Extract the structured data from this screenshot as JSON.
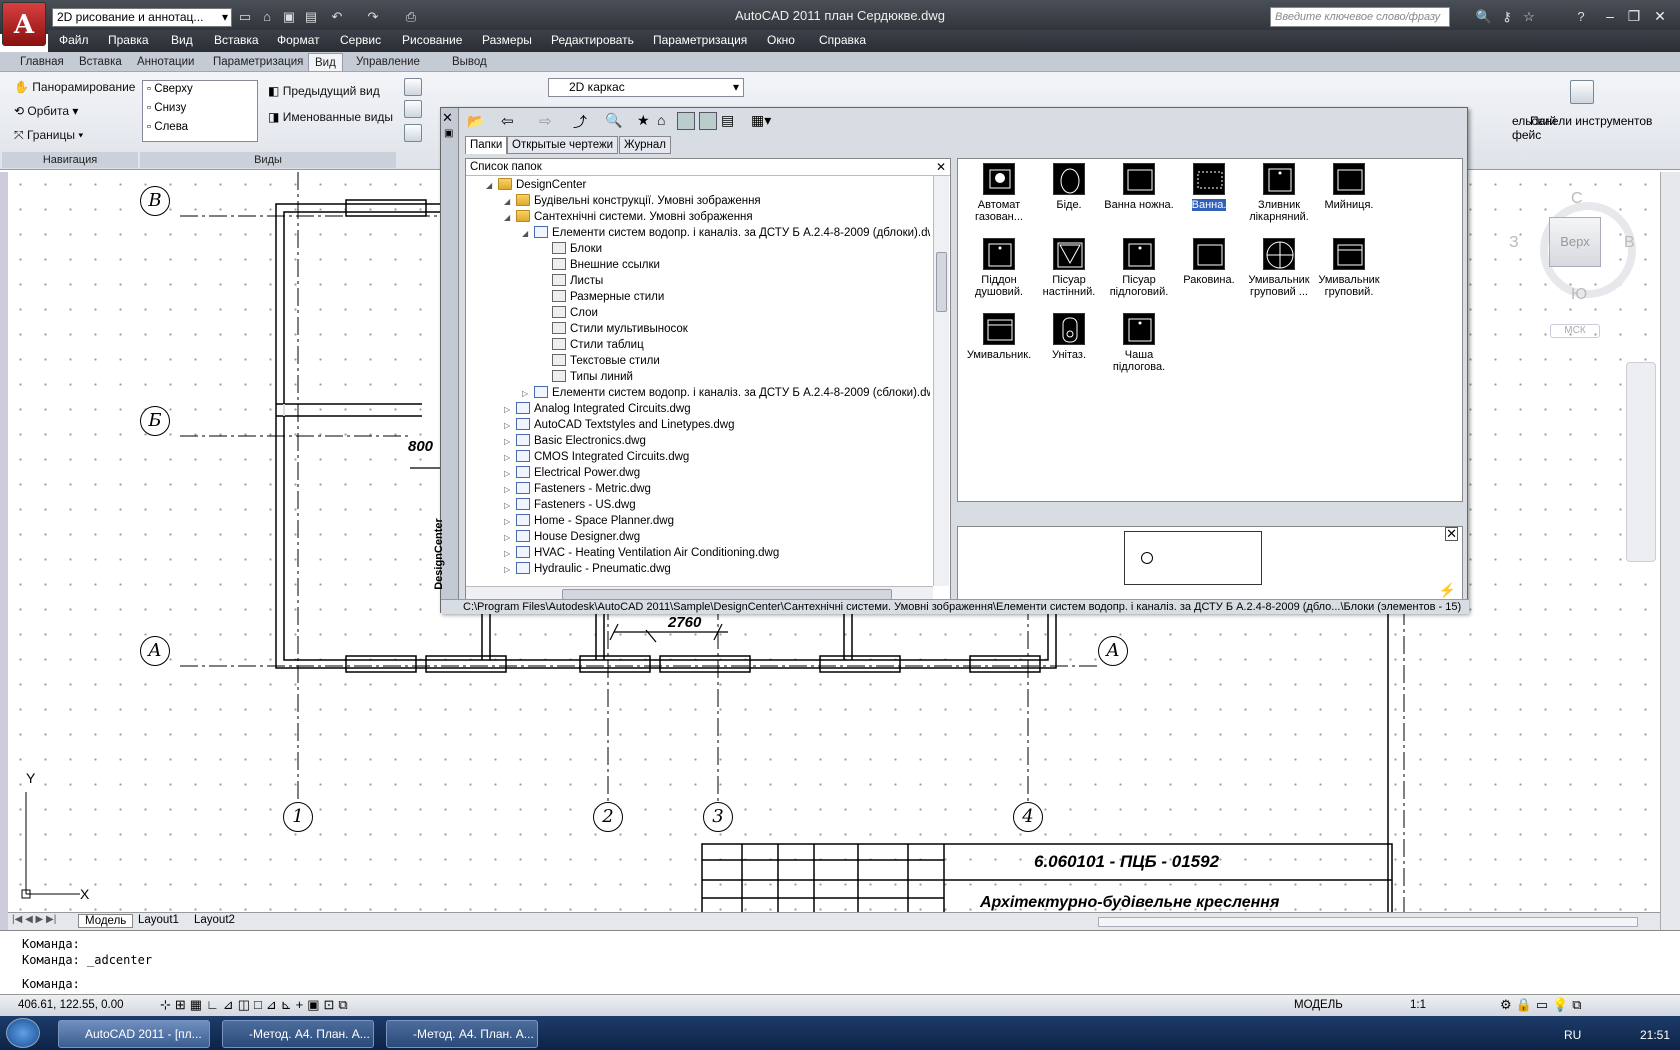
{
  "app": {
    "title": "AutoCAD 2011    план Сердюкве.dwg",
    "workspace": "2D рисование и аннотац...",
    "search_placeholder": "Введите ключевое слово/фразу",
    "logo_letter": "A"
  },
  "menu": [
    "Файл",
    "Правка",
    "Вид",
    "Вставка",
    "Формат",
    "Сервис",
    "Рисование",
    "Размеры",
    "Редактировать",
    "Параметризация",
    "Окно",
    "Справка"
  ],
  "ribbon_tabs": [
    "Главная",
    "Вставка",
    "Аннотации",
    "Параметризация",
    "Вид",
    "Управление",
    "Вывод"
  ],
  "ribbon_active_tab": "Вид",
  "ribbon": {
    "nav": {
      "pan": "Панорамирование",
      "orbit": "Орбита",
      "extents": "Границы",
      "title": "Навигация"
    },
    "views": {
      "items": [
        "Сверху",
        "Снизу",
        "Слева"
      ],
      "prev": "Предыдущий вид",
      "named": "Именованные виды",
      "title": "Виды"
    },
    "visual_style": "2D каркас",
    "ui_partial": "ельский\nфейс",
    "toolpalettes": "Панели инструментов",
    "ui_title_partial": "а"
  },
  "designcenter": {
    "side_title": "DesignCenter",
    "tabs": [
      "Папки",
      "Открытые чертежи",
      "Журнал"
    ],
    "tree_header": "Список папок",
    "tree": [
      {
        "indent": 1,
        "icon": "folder",
        "label": "DesignCenter"
      },
      {
        "indent": 2,
        "icon": "folder",
        "label": "Будівельні конструкції. Умовні зображення"
      },
      {
        "indent": 2,
        "icon": "folder",
        "label": "Сантехнічні системи. Умовні зображення"
      },
      {
        "indent": 3,
        "icon": "dwg",
        "label": "Елементи систем водопр. і каналіз. за ДСТУ Б А.2.4-8-2009 (дблоки).dwg"
      },
      {
        "indent": 4,
        "icon": "sub",
        "label": "Блоки"
      },
      {
        "indent": 4,
        "icon": "sub",
        "label": "Внешние ссылки"
      },
      {
        "indent": 4,
        "icon": "sub",
        "label": "Листы"
      },
      {
        "indent": 4,
        "icon": "sub",
        "label": "Размерные стили"
      },
      {
        "indent": 4,
        "icon": "sub",
        "label": "Слои"
      },
      {
        "indent": 4,
        "icon": "sub",
        "label": "Стили мультивыносок"
      },
      {
        "indent": 4,
        "icon": "sub",
        "label": "Стили таблиц"
      },
      {
        "indent": 4,
        "icon": "sub",
        "label": "Текстовые стили"
      },
      {
        "indent": 4,
        "icon": "sub",
        "label": "Типы линий"
      },
      {
        "indent": 3,
        "icon": "dwg",
        "label": "Елементи систем водопр. і каналіз. за ДСТУ Б А.2.4-8-2009 (сблоки).dwg"
      },
      {
        "indent": 2,
        "icon": "dwg",
        "label": "Analog Integrated Circuits.dwg"
      },
      {
        "indent": 2,
        "icon": "dwg",
        "label": "AutoCAD Textstyles and Linetypes.dwg"
      },
      {
        "indent": 2,
        "icon": "dwg",
        "label": "Basic Electronics.dwg"
      },
      {
        "indent": 2,
        "icon": "dwg",
        "label": "CMOS Integrated Circuits.dwg"
      },
      {
        "indent": 2,
        "icon": "dwg",
        "label": "Electrical Power.dwg"
      },
      {
        "indent": 2,
        "icon": "dwg",
        "label": "Fasteners - Metric.dwg"
      },
      {
        "indent": 2,
        "icon": "dwg",
        "label": "Fasteners - US.dwg"
      },
      {
        "indent": 2,
        "icon": "dwg",
        "label": "Home - Space Planner.dwg"
      },
      {
        "indent": 2,
        "icon": "dwg",
        "label": "House Designer.dwg"
      },
      {
        "indent": 2,
        "icon": "dwg",
        "label": "HVAC - Heating Ventilation Air Conditioning.dwg"
      },
      {
        "indent": 2,
        "icon": "dwg",
        "label": "Hydraulic - Pneumatic.dwg"
      }
    ],
    "blocks": [
      {
        "label": "Автомат газован...",
        "shape": "circle-fill"
      },
      {
        "label": "Біде.",
        "shape": "egg"
      },
      {
        "label": "Ванна ножна.",
        "shape": "rect"
      },
      {
        "label": "Ванна.",
        "shape": "rect-sel",
        "selected": true
      },
      {
        "label": "Зливник лікарняний.",
        "shape": "rect-dot"
      },
      {
        "label": "Мийниця.",
        "shape": "rect"
      },
      {
        "label": "Піддон душовий.",
        "shape": "rect-dot"
      },
      {
        "label": "Пісуар настінний.",
        "shape": "tri"
      },
      {
        "label": "Пісуар підлоговий.",
        "shape": "rect-dot"
      },
      {
        "label": "Раковина.",
        "shape": "rect"
      },
      {
        "label": "Умивальник груповий ...",
        "shape": "circle-cross"
      },
      {
        "label": "Умивальник груповий.",
        "shape": "rect-top"
      },
      {
        "label": "Умивальник.",
        "shape": "rect-top"
      },
      {
        "label": "Унітаз.",
        "shape": "toilet"
      },
      {
        "label": "Чаша підлогова.",
        "shape": "rect-dot"
      }
    ],
    "status_path": "C:\\Program Files\\Autodesk\\AutoCAD 2011\\Sample\\DesignCenter\\Сантехнічні системи. Умовні зображення\\Елементи систем водопр. і каналіз. за ДСТУ Б А.2.4-8-2009 (дбло...\\Блоки (элементов - 15)"
  },
  "drawing": {
    "axes_letters": [
      "В",
      "Б",
      "А",
      "А"
    ],
    "axes_numbers": [
      "1",
      "2",
      "3",
      "4"
    ],
    "dim_800": "800",
    "dim_2760": "2760",
    "stamp_code": "6.060101 - ПЦБ - 01592",
    "stamp_title": "Архітектурно-будівельне креслення",
    "ucs_y": "Y",
    "ucs_x": "X"
  },
  "viewcube": {
    "top": "Верх",
    "n": "С",
    "s": "Ю",
    "w": "З",
    "e": "В",
    "ucs": "МСК"
  },
  "layout_tabs": [
    "Модель",
    "Layout1",
    "Layout2"
  ],
  "command": {
    "line1": "Команда:",
    "line2": "Команда: _adcenter",
    "prompt": "Команда:"
  },
  "status": {
    "coords": "406.61, 122.55, 0.00",
    "model": "МОДЕЛЬ",
    "scale": "1:1"
  },
  "taskbar": {
    "items": [
      "AutoCAD 2011 - [пл...",
      "-Метод. А4. План. А...",
      "-Метод. А4. План. А..."
    ],
    "lang": "RU",
    "time": "21:51"
  },
  "colors": {
    "selection": "#3060b8",
    "title_bg": "#3a3e45"
  }
}
